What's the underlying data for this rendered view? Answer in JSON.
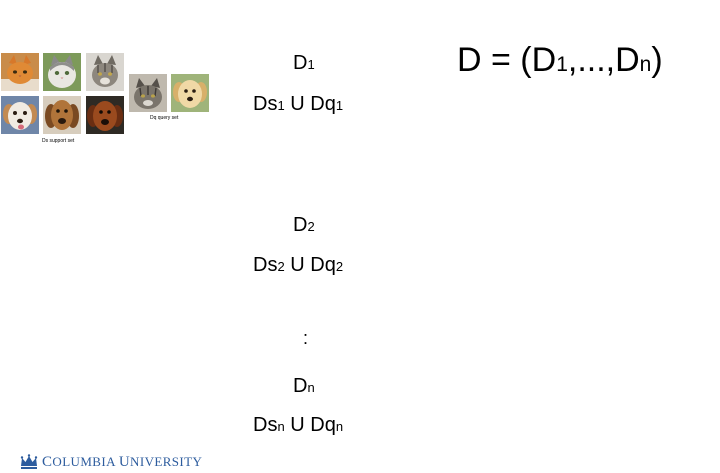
{
  "collage": {
    "support_caption": "Ds support set",
    "query_caption": "Dq query set",
    "support_images": [
      {
        "icon": "orange-tabby-cat-photo"
      },
      {
        "icon": "white-gray-cat-photo"
      },
      {
        "icon": "gray-tabby-cat-photo"
      },
      {
        "icon": "white-puppy-photo"
      },
      {
        "icon": "brown-dog-photo"
      },
      {
        "icon": "dark-brown-dog-photo"
      }
    ],
    "query_images": [
      {
        "icon": "tabby-cat-photo"
      },
      {
        "icon": "yellow-lab-puppy-photo"
      }
    ]
  },
  "formula": {
    "lhs": "D = (D",
    "sub1": "1",
    "mid": ",...,D",
    "subn": "n",
    "close": ")"
  },
  "tasks": [
    {
      "d": "D",
      "d_sub": "1",
      "ds": "Ds",
      "ds_sub": "1",
      "u": "U",
      "dq": "Dq",
      "dq_sub": "1"
    },
    {
      "d": "D",
      "d_sub": "2",
      "ds": "Ds",
      "ds_sub": "2",
      "u": "U",
      "dq": "Dq",
      "dq_sub": "2"
    },
    {
      "d": "D",
      "d_sub": "n",
      "ds": "Ds",
      "ds_sub": "n",
      "u": "U",
      "dq": "Dq",
      "dq_sub": "n"
    }
  ],
  "ellipsis": ":",
  "footer": {
    "logo_icon": "columbia-crown-icon",
    "logo_first_big": "C",
    "logo_first_rest": "OLUMBIA",
    "logo_second_big": "U",
    "logo_second_rest": "NIVERSITY"
  },
  "colors": {
    "logo_blue": "#2d5c9e",
    "text": "#000000",
    "background": "#ffffff"
  }
}
